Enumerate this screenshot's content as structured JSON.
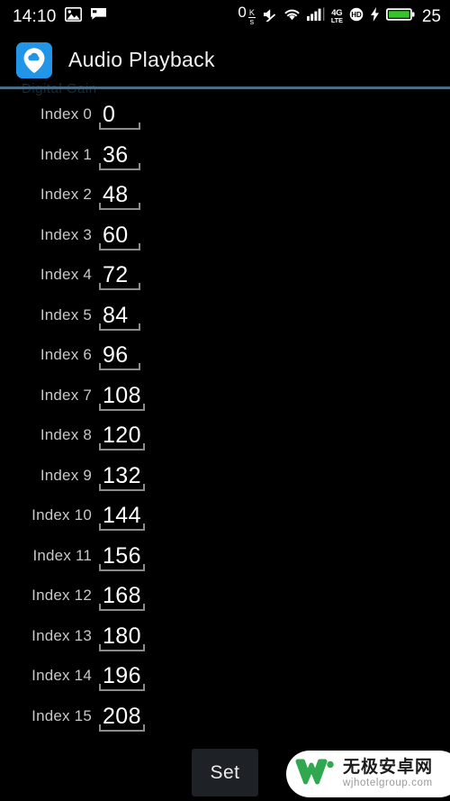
{
  "status_bar": {
    "clock": "14:10",
    "left_icons": [
      "photo-icon",
      "message-icon"
    ],
    "net_speed_value": "0",
    "net_speed_unit_top": "K",
    "net_speed_unit_bottom": "s",
    "right_icons": [
      "mute-icon",
      "wifi-icon",
      "signal-bars-icon",
      "4g-lte-icon",
      "hd-icon",
      "charging-bolt-icon",
      "battery-icon"
    ],
    "network_label_top": "4G",
    "network_label_bottom": "LTE",
    "hd_label": "HD",
    "battery_percent": "25",
    "battery_color": "#35c42b"
  },
  "header": {
    "app_icon": "cloud-pin-icon",
    "app_icon_color": "#2196e8",
    "title": "Audio Playback"
  },
  "section": {
    "ghost_label": "Digital Gain",
    "divider_color": "#4a6d87"
  },
  "list": {
    "rows": [
      {
        "label": "Index 0",
        "value": "0"
      },
      {
        "label": "Index 1",
        "value": "36"
      },
      {
        "label": "Index 2",
        "value": "48"
      },
      {
        "label": "Index 3",
        "value": "60"
      },
      {
        "label": "Index 4",
        "value": "72"
      },
      {
        "label": "Index 5",
        "value": "84"
      },
      {
        "label": "Index 6",
        "value": "96"
      },
      {
        "label": "Index 7",
        "value": "108"
      },
      {
        "label": "Index 8",
        "value": "120"
      },
      {
        "label": "Index 9",
        "value": "132"
      },
      {
        "label": "Index 10",
        "value": "144"
      },
      {
        "label": "Index 11",
        "value": "156"
      },
      {
        "label": "Index 12",
        "value": "168"
      },
      {
        "label": "Index 13",
        "value": "180"
      },
      {
        "label": "Index 14",
        "value": "196"
      },
      {
        "label": "Index 15",
        "value": "208"
      }
    ]
  },
  "footer": {
    "set_label": "Set"
  },
  "watermark": {
    "logo": "w-logo-icon",
    "logo_color": "#2fa84f",
    "brand_cn": "无极安卓网",
    "url": "wjhotelgroup.com"
  }
}
